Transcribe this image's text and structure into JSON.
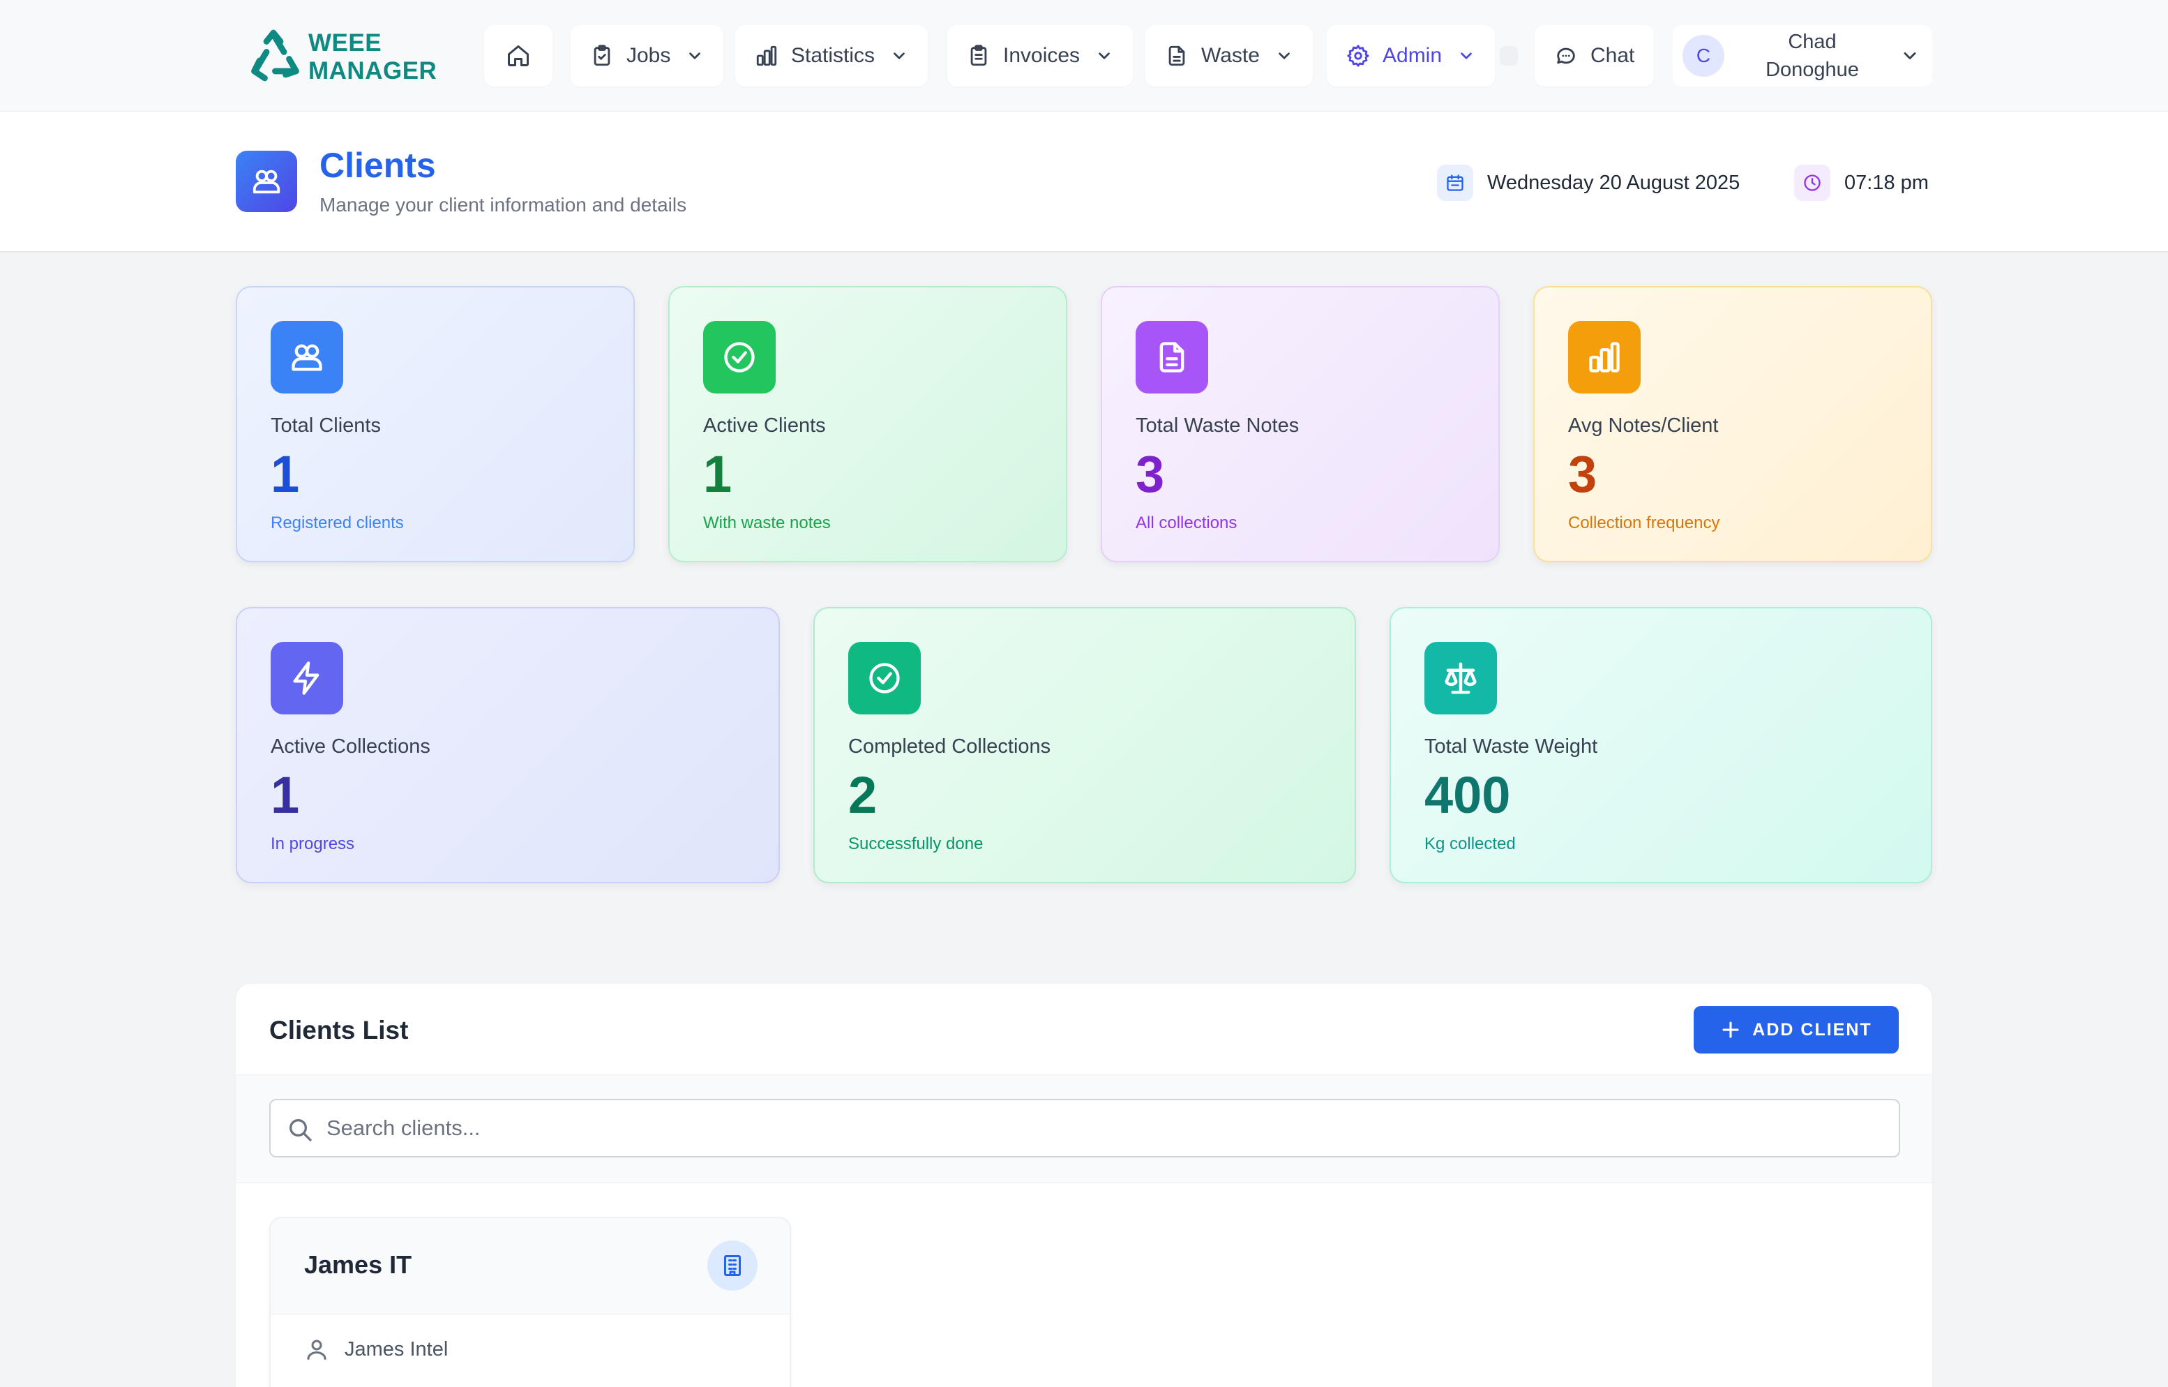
{
  "brand": {
    "line1": "WEEE",
    "line2": "MANAGER",
    "accent": "#0f8a83"
  },
  "nav": {
    "items": [
      {
        "id": "home",
        "label": "",
        "icon": "home-icon"
      },
      {
        "id": "jobs",
        "label": "Jobs",
        "icon": "clipboard-check-icon",
        "dropdown": true
      },
      {
        "id": "statistics",
        "label": "Statistics",
        "icon": "bar-chart-icon",
        "dropdown": true
      },
      {
        "id": "invoices",
        "label": "Invoices",
        "icon": "clipboard-list-icon",
        "dropdown": true
      },
      {
        "id": "waste",
        "label": "Waste",
        "icon": "file-icon",
        "dropdown": true
      },
      {
        "id": "admin",
        "label": "Admin",
        "icon": "gear-icon",
        "dropdown": true,
        "active": true
      },
      {
        "id": "chat",
        "label": "Chat",
        "icon": "chat-bubble-icon"
      }
    ],
    "user": {
      "initial": "C",
      "first_name": "Chad",
      "last_name": "Donoghue"
    }
  },
  "header": {
    "title": "Clients",
    "subtitle": "Manage your client information and details",
    "date": "Wednesday 20 August 2025",
    "time": "07:18 pm"
  },
  "stats": {
    "row1": [
      {
        "label": "Total Clients",
        "value": "1",
        "sub": "Registered clients",
        "color": "#3b82f6",
        "value_color": "#1d4ed8",
        "sub_color": "#3b82f6"
      },
      {
        "label": "Active Clients",
        "value": "1",
        "sub": "With waste notes",
        "color": "#22c55e",
        "value_color": "#15803d",
        "sub_color": "#16a34a"
      },
      {
        "label": "Total Waste Notes",
        "value": "3",
        "sub": "All collections",
        "color": "#a855f7",
        "value_color": "#7e22ce",
        "sub_color": "#9333ea"
      },
      {
        "label": "Avg Notes/Client",
        "value": "3",
        "sub": "Collection frequency",
        "color": "#f59e0b",
        "value_color": "#c2410c",
        "sub_color": "#d97706"
      }
    ],
    "row2": [
      {
        "label": "Active Collections",
        "value": "1",
        "sub": "In progress",
        "color": "#6366f1",
        "value_color": "#3730a3",
        "sub_color": "#4f46e5"
      },
      {
        "label": "Completed Collections",
        "value": "2",
        "sub": "Successfully done",
        "color": "#10b981",
        "value_color": "#047857",
        "sub_color": "#059669"
      },
      {
        "label": "Total Waste Weight",
        "value": "400",
        "sub": "Kg collected",
        "color": "#14b8a6",
        "value_color": "#0f766e",
        "sub_color": "#0d9488"
      }
    ]
  },
  "clients_list": {
    "title": "Clients List",
    "add_label": "ADD CLIENT",
    "search_placeholder": "Search clients...",
    "search_value": "",
    "clients": [
      {
        "name": "James IT",
        "contact": "James Intel"
      }
    ]
  }
}
